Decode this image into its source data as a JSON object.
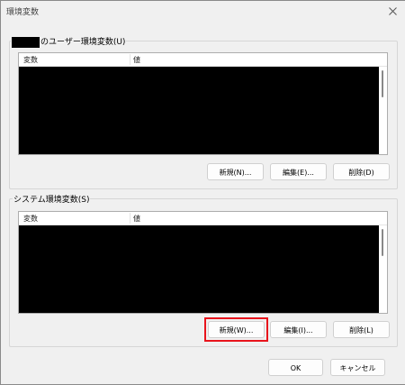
{
  "window": {
    "title": "環境変数"
  },
  "user_vars": {
    "group_label": "のユーザー環境変数(U)",
    "columns": [
      "変数",
      "値"
    ],
    "new_button": "新規(N)...",
    "edit_button": "編集(E)...",
    "delete_button": "削除(D)"
  },
  "system_vars": {
    "group_label": "システム環境変数(S)",
    "columns": [
      "変数",
      "値"
    ],
    "new_button": "新規(W)...",
    "edit_button": "編集(I)...",
    "delete_button": "削除(L)"
  },
  "footer": {
    "ok_button": "OK",
    "cancel_button": "キャンセル"
  },
  "colors": {
    "highlight": "#e8141c",
    "background": "#f0f0f0"
  },
  "icons": {
    "close": "close-icon"
  }
}
